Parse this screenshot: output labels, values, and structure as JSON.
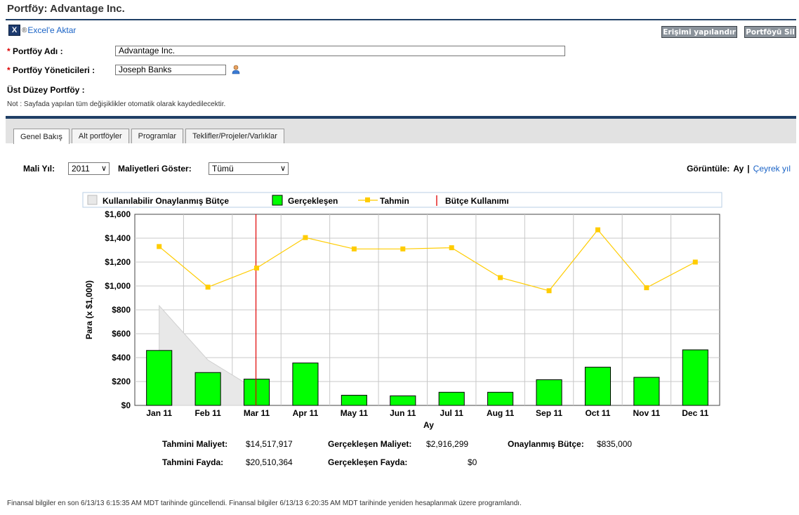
{
  "page": {
    "title": "Portföy: Advantage Inc."
  },
  "toolbar": {
    "excel_label": "Excel'e Aktar",
    "reg_mark": "®",
    "access_button": "Erişimi yapılandır",
    "delete_button": "Portföyü Sil"
  },
  "form": {
    "name_label": "Portföy Adı :",
    "name_value": "Advantage Inc.",
    "managers_label": "Portföy Yöneticileri :",
    "managers_value": "Joseph Banks",
    "parent_label": "Üst Düzey Portföy :",
    "note": "Not : Sayfada yapılan tüm değişiklikler otomatik olarak kaydedilecektir.",
    "required_mark": "*"
  },
  "tabs": [
    {
      "label": "Genel Bakış",
      "active": true
    },
    {
      "label": "Alt portföyler",
      "active": false
    },
    {
      "label": "Programlar",
      "active": false
    },
    {
      "label": "Teklifler/Projeler/Varlıklar",
      "active": false
    }
  ],
  "controls": {
    "fiscal_year_label": "Mali Yıl:",
    "fiscal_year_value": "2011",
    "show_costs_label": "Maliyetleri Göster:",
    "show_costs_value": "Tümü",
    "view_label": "Görüntüle:",
    "view_month": "Ay",
    "view_sep": "|",
    "view_quarter": "Çeyrek yıl"
  },
  "chart_data": {
    "type": "bar",
    "categories": [
      "Jan 11",
      "Feb 11",
      "Mar 11",
      "Apr 11",
      "May 11",
      "Jun 11",
      "Jul 11",
      "Aug 11",
      "Sep 11",
      "Oct 11",
      "Nov 11",
      "Dec 11"
    ],
    "xlabel": "Ay",
    "ylabel": "Para (x $1,000)",
    "ylim": [
      0,
      1600
    ],
    "yticks": [
      "$0",
      "$200",
      "$400",
      "$600",
      "$800",
      "$1,000",
      "$1,200",
      "$1,400",
      "$1,600"
    ],
    "grid": true,
    "legend_position": "top",
    "series": [
      {
        "name": "Kullanılabilir Onaylanmış Bütçe",
        "kind": "area",
        "color": "#e8e8e8",
        "values": [
          835,
          380,
          130,
          null,
          null,
          null,
          null,
          null,
          null,
          null,
          null,
          null
        ]
      },
      {
        "name": "Gerçekleşen",
        "kind": "bar",
        "color": "#00ff00",
        "values": [
          460,
          275,
          220,
          355,
          85,
          80,
          110,
          110,
          215,
          320,
          235,
          465
        ]
      },
      {
        "name": "Tahmin",
        "kind": "line",
        "color": "#ffcc00",
        "values": [
          1330,
          990,
          1150,
          1405,
          1310,
          1310,
          1320,
          1070,
          960,
          1470,
          985,
          1200
        ]
      },
      {
        "name": "Bütçe Kullanımı",
        "kind": "marker",
        "color": "#e00000",
        "at_category": "Mar 11"
      }
    ]
  },
  "summary": {
    "est_cost_label": "Tahmini Maliyet:",
    "est_cost_value": "$14,517,917",
    "actual_cost_label": "Gerçekleşen Maliyet:",
    "actual_cost_value": "$2,916,299",
    "approved_budget_label": "Onaylanmış Bütçe:",
    "approved_budget_value": "$835,000",
    "est_benefit_label": "Tahmini Fayda:",
    "est_benefit_value": "$20,510,364",
    "actual_benefit_label": "Gerçekleşen Fayda:",
    "actual_benefit_value": "$0"
  },
  "footer": {
    "text": "Finansal bilgiler en son 6/13/13 6:15:35 AM MDT tarihinde güncellendi. Finansal bilgiler 6/13/13 6:20:35 AM MDT tarihinde yeniden hesaplanmak üzere programlandı."
  }
}
